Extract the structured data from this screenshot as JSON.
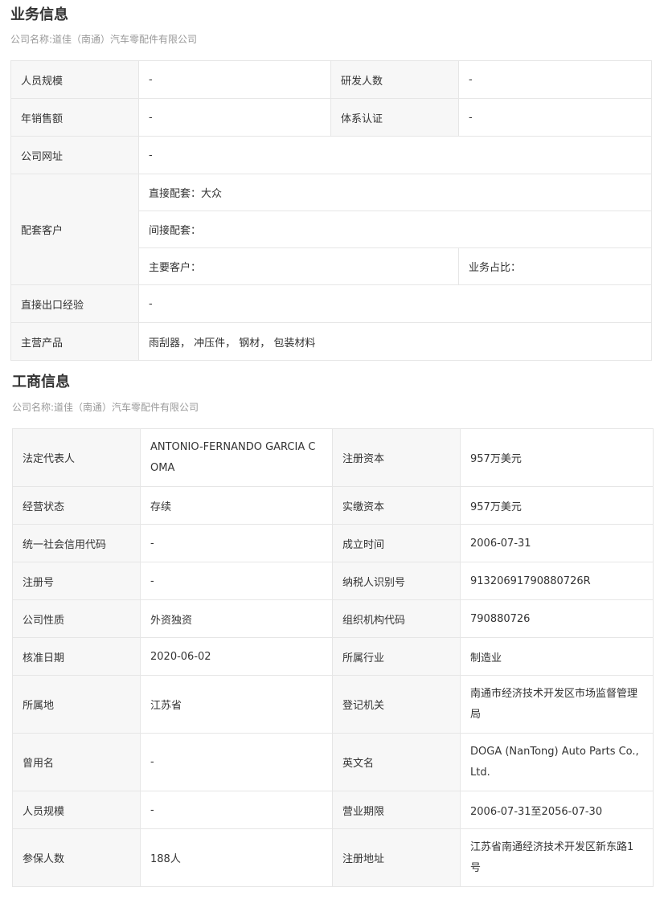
{
  "business": {
    "title": "业务信息",
    "subtitle": "公司名称:道佳（南通）汽车零配件有限公司",
    "rows": {
      "staff_size": {
        "label": "人员规模",
        "value": "-"
      },
      "rd_count": {
        "label": "研发人数",
        "value": "-"
      },
      "annual_sales": {
        "label": "年销售额",
        "value": "-"
      },
      "certification": {
        "label": "体系认证",
        "value": "-"
      },
      "website": {
        "label": "公司网址",
        "value": "-"
      },
      "customers": {
        "label": "配套客户",
        "direct": "直接配套：大众",
        "indirect": "间接配套：",
        "main": "主要客户：",
        "share": "业务占比："
      },
      "export": {
        "label": "直接出口经验",
        "value": "-"
      },
      "products": {
        "label": "主营产品",
        "value": "雨刮器， 冲压件， 钢材， 包装材料"
      }
    }
  },
  "registration": {
    "title": "工商信息",
    "subtitle": "公司名称:道佳（南通）汽车零配件有限公司",
    "rows": {
      "legal_rep": {
        "label": "法定代表人",
        "value": "ANTONIO-FERNANDO GARCIA COMA"
      },
      "reg_capital": {
        "label": "注册资本",
        "value": "957万美元"
      },
      "status": {
        "label": "经营状态",
        "value": "存续"
      },
      "paid_capital": {
        "label": "实缴资本",
        "value": "957万美元"
      },
      "credit_code": {
        "label": "统一社会信用代码",
        "value": "-"
      },
      "founded": {
        "label": "成立时间",
        "value": "2006-07-31"
      },
      "reg_no": {
        "label": "注册号",
        "value": "-"
      },
      "taxpayer_id": {
        "label": "纳税人识别号",
        "value": "91320691790880726R"
      },
      "company_type": {
        "label": "公司性质",
        "value": "外资独资"
      },
      "org_code": {
        "label": "组织机构代码",
        "value": "790880726"
      },
      "approval_date": {
        "label": "核准日期",
        "value": "2020-06-02"
      },
      "industry": {
        "label": "所属行业",
        "value": "制造业"
      },
      "location": {
        "label": "所属地",
        "value": "江苏省"
      },
      "reg_authority": {
        "label": "登记机关",
        "value": "南通市经济技术开发区市场监督管理局"
      },
      "former_name": {
        "label": "曾用名",
        "value": "-"
      },
      "english_name": {
        "label": "英文名",
        "value": "DOGA (NanTong) Auto Parts Co., Ltd."
      },
      "staff_size": {
        "label": "人员规模",
        "value": "-"
      },
      "term": {
        "label": "营业期限",
        "value": "2006-07-31至2056-07-30"
      },
      "insured": {
        "label": "参保人数",
        "value": "188人"
      },
      "address": {
        "label": "注册地址",
        "value": "江苏省南通经济技术开发区新东路1号"
      }
    }
  }
}
